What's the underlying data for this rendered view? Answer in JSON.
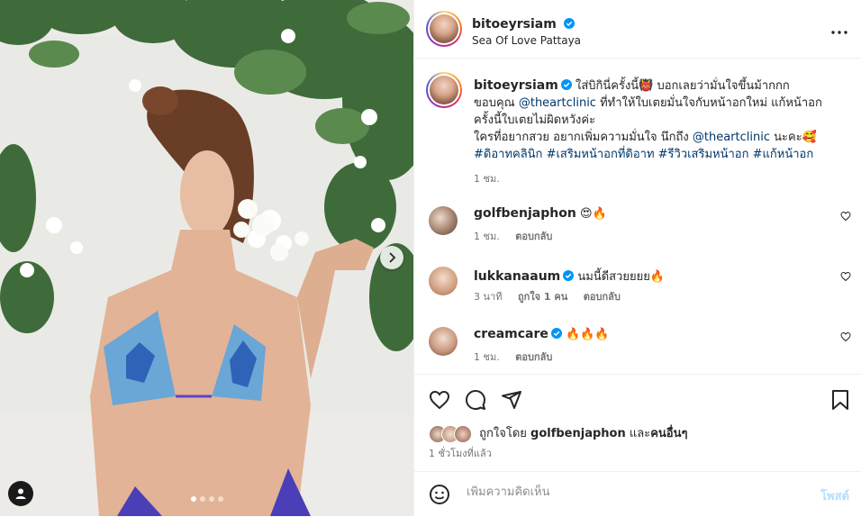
{
  "post": {
    "username": "bitoeyrsiam",
    "location": "Sea Of Love Pattaya",
    "more_icon": "more-horizontal-icon",
    "slide_count": 4,
    "active_slide": 1
  },
  "caption": {
    "line1": "ใส่บิกินี่ครั้งนี้👹 บอกเลยว่ามั่นใจขึ้นม้ากกก",
    "line2_prefix": "ขอบคุณ ",
    "line2_mention": "@theartclinic",
    "line2_suffix": " ที่ทำให้ใบเตยมั่นใจกับหน้าอกใหม่ แก้หน้าอก",
    "line3": "ครั้งนี้ใบเตยไม่ผิดหวังค่ะ",
    "line4_prefix": "ใครที่อยากสวย อยากเพิ่มความมั่นใจ นึกถึง ",
    "line4_mention": "@theartclinic",
    "line4_suffix": " นะคะ🥰",
    "hashtags": "#ดิอาทคลินิก #เสริมหน้าอกที่ดิอาท #รีวิวเสริมหน้าอก #แก้หน้าอก",
    "time": "1 ชม."
  },
  "comments": [
    {
      "username": "golfbenjaphon",
      "verified": false,
      "text": "😍🔥",
      "time": "1 ชม.",
      "likes": "",
      "reply": "ตอบกลับ"
    },
    {
      "username": "lukkanaaum",
      "verified": true,
      "text": "นมนี้ดีสวยยยย🔥",
      "time": "3 นาที",
      "likes": "ถูกใจ 1 คน",
      "reply": "ตอบกลับ"
    },
    {
      "username": "creamcare",
      "verified": true,
      "text": "🔥🔥🔥",
      "time": "1 ชม.",
      "likes": "",
      "reply": "ตอบกลับ"
    }
  ],
  "likes": {
    "prefix": "ถูกใจโดย ",
    "user": "golfbenjaphon",
    "middle": " และ",
    "others": "คนอื่นๆ"
  },
  "posted_ago": "1 ชั่วโมงที่แล้ว",
  "add_comment": {
    "placeholder": "เพิ่มความคิดเห็น",
    "post_label": "โพสต์"
  },
  "colors": {
    "verified": "#0095f6",
    "link": "#00376b",
    "post_button_disabled": "#b2dffc"
  }
}
